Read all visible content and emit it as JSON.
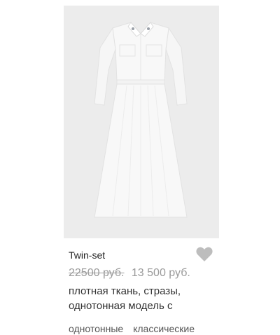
{
  "product": {
    "brand": "Twin-set",
    "old_price": "22500 руб.",
    "new_price": "13 500 руб.",
    "description_lines": [
      "плотная ткань, стразы,",
      "однотонная модель с"
    ],
    "tags": [
      "однотонные",
      "классические"
    ],
    "favorite_icon": "heart-icon",
    "colors": {
      "image_bg": "#ececec",
      "dress": "#f7f7f7",
      "heart": "#bdbdbd"
    }
  }
}
